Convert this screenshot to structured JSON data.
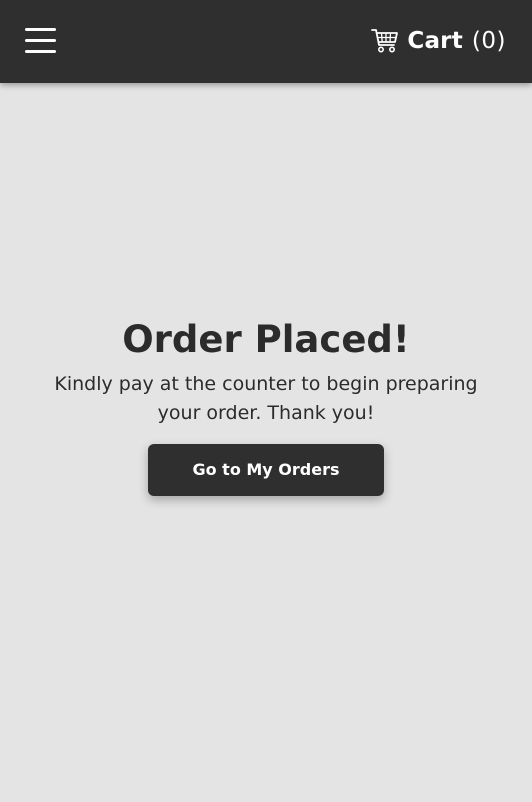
{
  "header": {
    "menu_icon": "hamburger-menu-icon",
    "cart_icon": "shopping-cart-icon",
    "cart_label": "Cart",
    "cart_count": "(0)"
  },
  "main": {
    "title": "Order Placed!",
    "message": "Kindly pay at the counter to begin preparing your order. Thank you!",
    "button_label": "Go to My Orders"
  },
  "colors": {
    "header_bg": "#2f2f2f",
    "page_bg": "#e4e4e4",
    "text": "#2b2b2b",
    "button_bg": "#2f2f2f",
    "button_text": "#ffffff"
  }
}
